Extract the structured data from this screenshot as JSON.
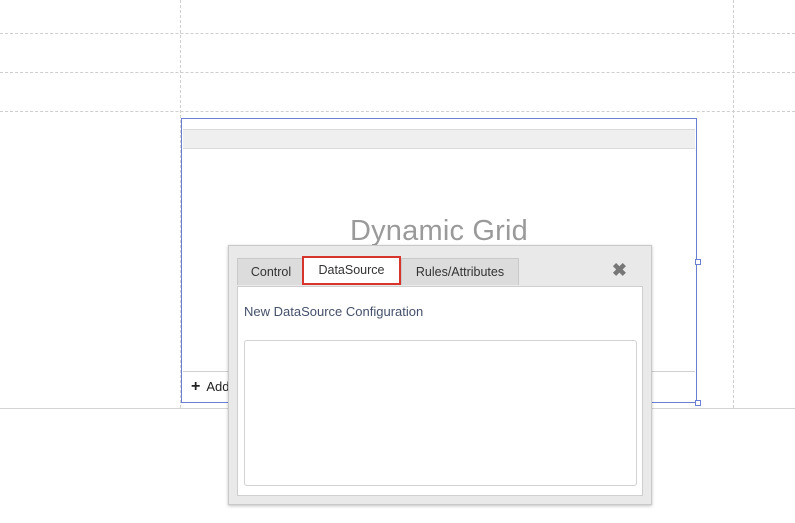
{
  "grid_control": {
    "title": "Dynamic Grid",
    "add_label": "Add"
  },
  "dialog": {
    "tabs": [
      {
        "label": "Control",
        "active": false
      },
      {
        "label": "DataSource",
        "active": true
      },
      {
        "label": "Rules/Attributes",
        "active": false
      }
    ],
    "close_icon": "close-icon",
    "panel": {
      "heading": "New DataSource Configuration"
    }
  },
  "colors": {
    "selection_border": "#6a7fd4",
    "active_tab_border": "#d9342b"
  }
}
